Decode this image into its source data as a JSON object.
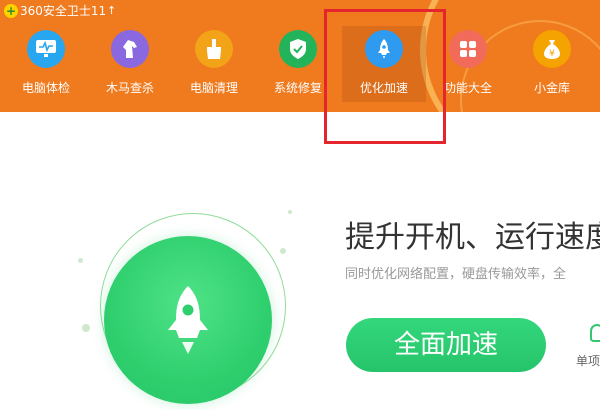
{
  "app": {
    "title": "360安全卫士11"
  },
  "colors": {
    "header": "#f07a1e",
    "accent": "#2fcf6e",
    "highlight_box": "#e4252e"
  },
  "nav": [
    {
      "label": "电脑体检",
      "icon": "monitor-check-icon",
      "color": "#29a6f0"
    },
    {
      "label": "木马查杀",
      "icon": "horse-icon",
      "color": "#8a68e0"
    },
    {
      "label": "电脑清理",
      "icon": "broom-icon",
      "color": "#f3a317"
    },
    {
      "label": "系统修复",
      "icon": "shield-check-icon",
      "color": "#22b35b"
    },
    {
      "label": "优化加速",
      "icon": "rocket-icon",
      "color": "#2f9bf0",
      "active": true
    },
    {
      "label": "功能大全",
      "icon": "grid-icon",
      "color": "#f26b5a"
    },
    {
      "label": "小金库",
      "icon": "money-bag-icon",
      "color": "#f5a300"
    }
  ],
  "main": {
    "headline": "提升开机、运行速度",
    "subline": "同时优化网络配置，硬盘传输效率，全",
    "button_label": "全面加速",
    "side_link": "单项"
  }
}
